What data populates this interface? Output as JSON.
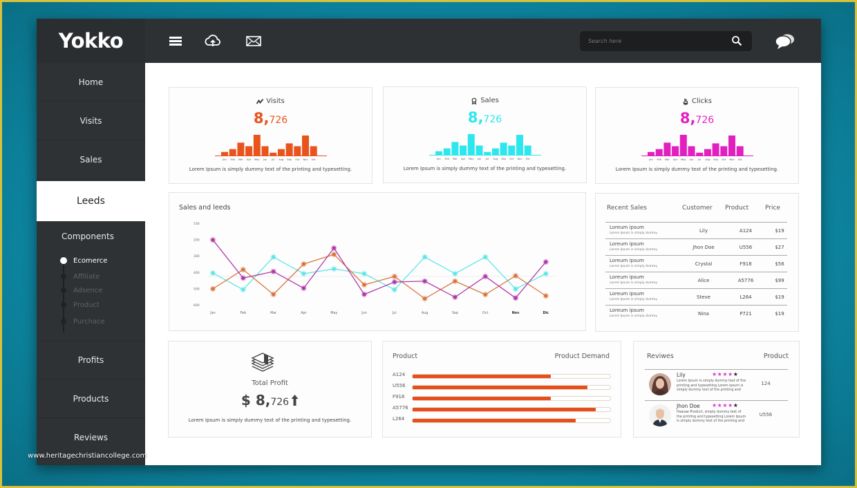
{
  "app": {
    "brand": "Yokko"
  },
  "header": {
    "icons": [
      "menu-icon",
      "cloud-upload-icon",
      "mail-icon"
    ],
    "search_placeholder": "Search here",
    "search_icon": "search-icon",
    "chat_icon": "chat-icon"
  },
  "sidebar": {
    "items": [
      {
        "label": "Home",
        "active": false
      },
      {
        "label": "Visits",
        "active": false
      },
      {
        "label": "Sales",
        "active": false
      },
      {
        "label": "Leeds",
        "active": true
      },
      {
        "label": "Profits",
        "active": false
      },
      {
        "label": "Products",
        "active": false
      },
      {
        "label": "Reviews",
        "active": false
      }
    ],
    "components": {
      "title": "Components",
      "items": [
        {
          "label": "Ecomerce",
          "active": true
        },
        {
          "label": "Affiliate",
          "active": false
        },
        {
          "label": "Adsence",
          "active": false
        },
        {
          "label": "Product",
          "active": false
        },
        {
          "label": "Purchace",
          "active": false
        }
      ]
    }
  },
  "stats": [
    {
      "title": "Visits",
      "icon": "trend-icon",
      "value_big": "8,",
      "value_small": "726",
      "color": "#e8541c",
      "desc": "Lorem Ipsum is simply dummy text of the printing and typesetting."
    },
    {
      "title": "Sales",
      "icon": "award-icon",
      "value_big": "8,",
      "value_small": "726",
      "color": "#2ee6ee",
      "desc": "Lorem Ipsum is simply dummy text of the printing and typesetting."
    },
    {
      "title": "Clicks",
      "icon": "pointer-icon",
      "value_big": "8,",
      "value_small": "726",
      "color": "#e21fbf",
      "desc": "Lorem Ipsum is simply dummy text of the printing and typesetting."
    }
  ],
  "recent_sales": {
    "headers": [
      "Recent Sales",
      "Customer",
      "Product",
      "Price"
    ],
    "rows": [
      {
        "title": "Loreum ipsum",
        "subtitle": "Lorem Ipsum is simply dummy",
        "customer": "Lily",
        "product": "A124",
        "price": "$19"
      },
      {
        "title": "Loreum ipsum",
        "subtitle": "Lorem Ipsum is simply dummy",
        "customer": "Jhon Doe",
        "product": "U556",
        "price": "$27"
      },
      {
        "title": "Loreum ipsum",
        "subtitle": "Lorem Ipsum is simply dummy",
        "customer": "Crystal",
        "product": "F918",
        "price": "$56"
      },
      {
        "title": "Loreum ipsum",
        "subtitle": "Lorem Ipsum is simply dummy",
        "customer": "Alice",
        "product": "A5776",
        "price": "$99"
      },
      {
        "title": "Loreum ipsum",
        "subtitle": "Lorem Ipsum is simply dummy",
        "customer": "Steve",
        "product": "L264",
        "price": "$19"
      },
      {
        "title": "Loreum ipsum",
        "subtitle": "Lorem Ipsum is simply dummy",
        "customer": "Nina",
        "product": "P721",
        "price": "$19"
      }
    ]
  },
  "profit": {
    "icon": "money-stack-icon",
    "title": "Total Profit",
    "currency": "$ ",
    "value_big": "8,",
    "value_small": "726",
    "trend_icon": "arrow-up-icon",
    "desc": "Lorem Ipsum is simply dummy text of the printing and typesetting."
  },
  "product_demand": {
    "header_left": "Product",
    "header_right": "Product Demand",
    "color": "#e84e1b",
    "rows": [
      {
        "label": "A124",
        "fraction": 0.7
      },
      {
        "label": "U556",
        "fraction": 0.885
      },
      {
        "label": "F918",
        "fraction": 0.7
      },
      {
        "label": "A5776",
        "fraction": 0.925
      },
      {
        "label": "L264",
        "fraction": 0.825
      }
    ]
  },
  "reviews": {
    "header_left": "Reviwes",
    "header_right": "Product",
    "star_color": "#d63cc8",
    "rows": [
      {
        "name": "Lily",
        "rating": 4,
        "max": 5,
        "text": "Lorem Ipsum is simply dummy text of the printing and typesetting Lorem Ipsum is simply dummy text of the printing and",
        "product": "124",
        "avatar": "avatar-woman"
      },
      {
        "name": "Jhon Doe",
        "rating": 4,
        "max": 5,
        "text": "Haasae Product, simply dummy text of the printing and typesetting Lorem Ipsum is simply dummy text of the printing and",
        "product": "U556",
        "avatar": "avatar-man"
      }
    ]
  },
  "watermark": "www.heritagechristiancollege.com",
  "chart_data": [
    {
      "type": "bar",
      "title": "Visits",
      "categories": [
        "Jan",
        "Feb",
        "Mar",
        "Apr",
        "May",
        "Jun",
        "Jul",
        "Aug",
        "Sep",
        "Oct",
        "Nov",
        "Dic"
      ],
      "values": [
        5,
        9,
        18,
        13,
        29,
        13,
        4,
        9,
        17,
        13,
        28,
        13
      ],
      "color": "#e8541c"
    },
    {
      "type": "bar",
      "title": "Sales",
      "categories": [
        "Jan",
        "Feb",
        "Mar",
        "Apr",
        "May",
        "Jun",
        "Jul",
        "Aug",
        "Sep",
        "Oct",
        "Nov",
        "Dic"
      ],
      "values": [
        5,
        9,
        18,
        13,
        29,
        13,
        4,
        9,
        17,
        13,
        28,
        13
      ],
      "color": "#2ee6ee"
    },
    {
      "type": "bar",
      "title": "Clicks",
      "categories": [
        "Jan",
        "Feb",
        "Mar",
        "Apr",
        "May",
        "Jun",
        "Jul",
        "Aug",
        "Sep",
        "Oct",
        "Nov",
        "Dic"
      ],
      "values": [
        5,
        9,
        18,
        13,
        29,
        13,
        4,
        9,
        17,
        13,
        28,
        13
      ],
      "color": "#e21fbf"
    },
    {
      "type": "line",
      "title": "Sales and leeds",
      "categories": [
        "Jan",
        "Feb",
        "Mar",
        "Apr",
        "May",
        "Jun",
        "Jul",
        "Aug",
        "Sep",
        "Oct",
        "Nov",
        "Dic"
      ],
      "bold_categories": [
        "Nov",
        "Dic"
      ],
      "yticks": [
        100,
        200,
        300,
        400,
        500,
        600
      ],
      "ylim": [
        100,
        600
      ],
      "y_inverted": true,
      "grid": false,
      "series": [
        {
          "name": "cyan",
          "color": "#5fe6e6",
          "values": [
            405,
            507,
            307,
            409,
            380,
            409,
            507,
            307,
            409,
            307,
            503,
            409
          ]
        },
        {
          "name": "orange",
          "color": "#d9763f",
          "values": [
            502,
            384,
            536,
            350,
            291,
            477,
            426,
            562,
            455,
            537,
            422,
            545
          ]
        },
        {
          "name": "magenta",
          "color": "#b03aa8",
          "values": [
            202,
            436,
            396,
            498,
            252,
            536,
            460,
            455,
            553,
            426,
            558,
            337
          ]
        }
      ]
    }
  ]
}
